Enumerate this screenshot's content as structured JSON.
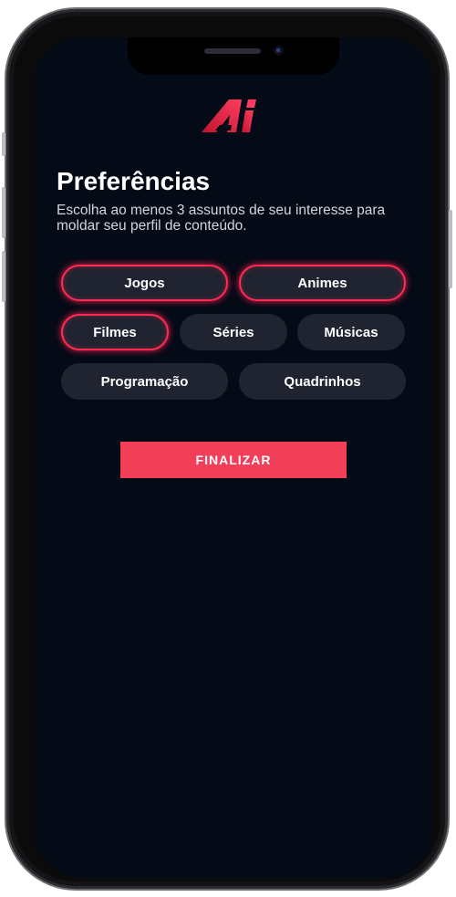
{
  "app": {
    "logo_icon": "ai-logo-icon",
    "accent_color": "#f23f59"
  },
  "header": {
    "title": "Preferências",
    "subtitle": "Escolha ao menos 3 assuntos de seu interesse para moldar seu perfil de conteúdo."
  },
  "tags": [
    {
      "label": "Jogos",
      "selected": true
    },
    {
      "label": "Animes",
      "selected": true
    },
    {
      "label": "Filmes",
      "selected": true
    },
    {
      "label": "Séries",
      "selected": false
    },
    {
      "label": "Músicas",
      "selected": false
    },
    {
      "label": "Programação",
      "selected": false
    },
    {
      "label": "Quadrinhos",
      "selected": false
    }
  ],
  "actions": {
    "finalize_label": "FINALIZAR"
  }
}
